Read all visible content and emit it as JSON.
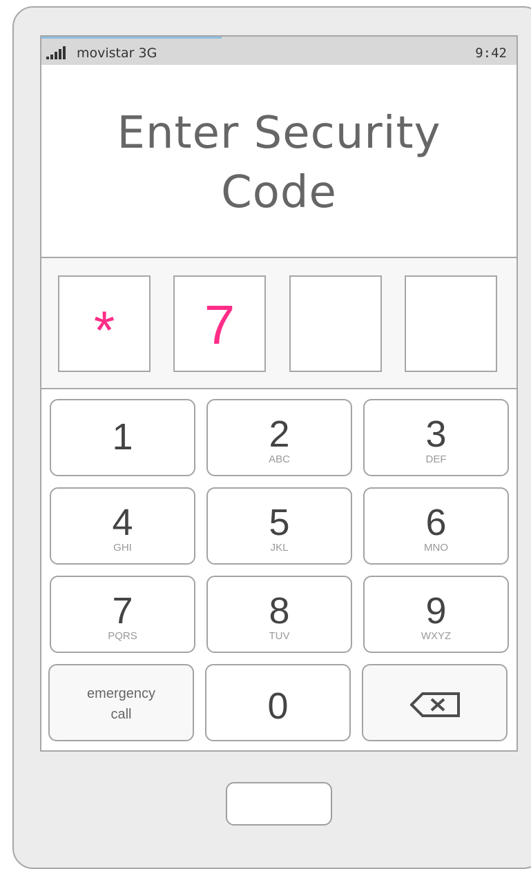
{
  "status_bar": {
    "carrier": "movistar 3G",
    "time": "9:42",
    "signal_bars": 5
  },
  "lock_screen": {
    "title_line1": "Enter Security",
    "title_line2": "Code",
    "code_digits": [
      "*",
      "7",
      "",
      ""
    ]
  },
  "keypad": {
    "keys": [
      {
        "digit": "1",
        "letters": ""
      },
      {
        "digit": "2",
        "letters": "ABC"
      },
      {
        "digit": "3",
        "letters": "DEF"
      },
      {
        "digit": "4",
        "letters": "GHI"
      },
      {
        "digit": "5",
        "letters": "JKL"
      },
      {
        "digit": "6",
        "letters": "MNO"
      },
      {
        "digit": "7",
        "letters": "PQRS"
      },
      {
        "digit": "8",
        "letters": "TUV"
      },
      {
        "digit": "9",
        "letters": "WXYZ"
      },
      {
        "digit": "0",
        "letters": ""
      }
    ],
    "emergency_line1": "emergency",
    "emergency_line2": "call",
    "backspace_icon": "backspace-icon"
  },
  "colors": {
    "accent_code": "#ff2d87",
    "status_bar": "#d8d8d8",
    "device_frame": "#ececec",
    "border": "#a7a7a7"
  }
}
